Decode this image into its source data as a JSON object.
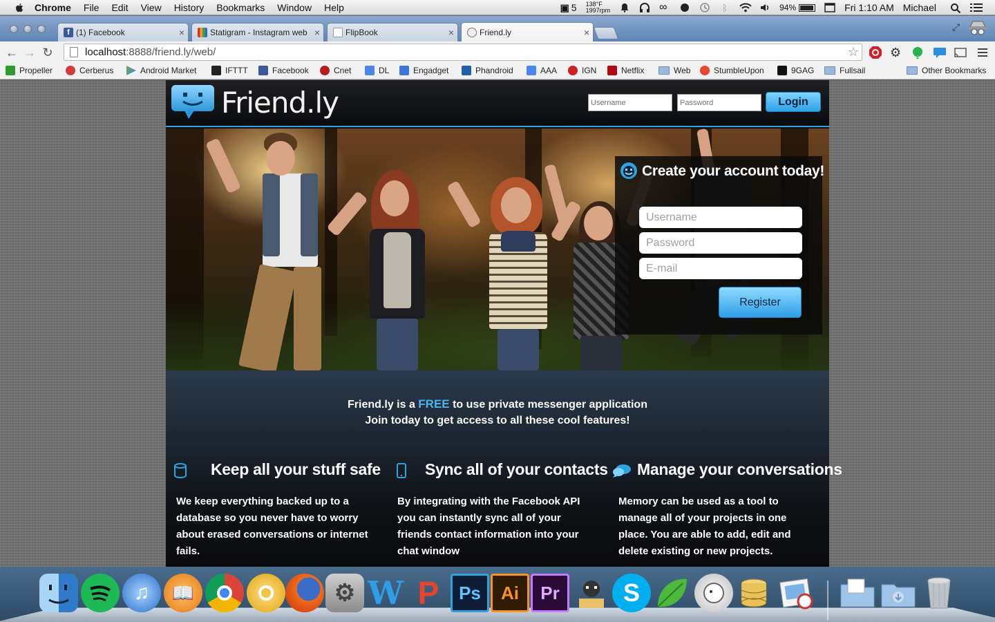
{
  "menubar": {
    "app_name": "Chrome",
    "menus": [
      "File",
      "Edit",
      "View",
      "History",
      "Bookmarks",
      "Window",
      "Help"
    ],
    "status_count": "5",
    "temp_line1": "138°F",
    "temp_line2": "1997rpm",
    "battery": "94%",
    "clock": "Fri 1:10 AM",
    "user": "Michael"
  },
  "tabs": [
    {
      "title": "(1) Facebook",
      "favicon_color": "#3b5998"
    },
    {
      "title": "Statigram - Instagram web",
      "favicon_color": "#8a5a2b"
    },
    {
      "title": "FlipBook",
      "favicon_color": "#ffffff"
    },
    {
      "title": "Friend.ly",
      "favicon_color": "#cccccc"
    }
  ],
  "address_bar": {
    "host": "localhost",
    "path": ":8888/friend.ly/web/"
  },
  "bookmarks": [
    {
      "label": "Propeller",
      "color": "#2f9b2f"
    },
    {
      "label": "Cerberus",
      "color": "#d23b3b"
    },
    {
      "label": "Android Market",
      "color": "#6aa84f"
    },
    {
      "label": "IFTTT",
      "color": "#222222"
    },
    {
      "label": "Facebook",
      "color": "#3b5998"
    },
    {
      "label": "Cnet",
      "color": "#b71c1c"
    },
    {
      "label": "DL",
      "color": "#4a86e8"
    },
    {
      "label": "Engadget",
      "color": "#3c78d8"
    },
    {
      "label": "Phandroid",
      "color": "#1f5fa8"
    },
    {
      "label": "AAA",
      "color": "#4a86e8"
    },
    {
      "label": "IGN",
      "color": "#cc2222"
    },
    {
      "label": "Netflix",
      "color": "#b20710"
    },
    {
      "label": "Web",
      "color": "folder"
    },
    {
      "label": "StumbleUpon",
      "color": "#e8452c"
    },
    {
      "label": "9GAG",
      "color": "#111111"
    },
    {
      "label": "Fullsail",
      "color": "folder"
    }
  ],
  "other_bookmarks": "Other Bookmarks",
  "site": {
    "logo_text": "Friend.ly",
    "header_username_placeholder": "Username",
    "header_password_placeholder": "Password",
    "login_label": "Login",
    "register": {
      "title": "Create your account today!",
      "username_placeholder": "Username",
      "password_placeholder": "Password",
      "email_placeholder": "E-mail",
      "button_label": "Register"
    },
    "tagline_pre": "Friend.ly is a",
    "tagline_free": "FREE",
    "tagline_post": "to use private messenger application",
    "tagline_line2": "Join today to get access to all these cool features!",
    "features": [
      {
        "title": "Keep all your stuff safe",
        "text": "We keep everything backed up to a database so you never have to worry about erased conversations or internet fails."
      },
      {
        "title": "Sync all of your contacts",
        "text": "By integrating with the Facebook API you can instantly sync all of your friends contact information into your chat window"
      },
      {
        "title": "Manage your conversations",
        "text": "Memory can be used as a tool to manage all of your projects in one place. You are able to add, edit and delete existing or new projects."
      }
    ]
  },
  "colors": {
    "accent": "#2fa3e0",
    "free_highlight": "#4ab6f0"
  },
  "dock": [
    {
      "name": "finder-icon"
    },
    {
      "name": "spotify-icon"
    },
    {
      "name": "itunes-icon"
    },
    {
      "name": "ibooks-icon"
    },
    {
      "name": "chrome-icon"
    },
    {
      "name": "chrome-canary-icon"
    },
    {
      "name": "firefox-icon"
    },
    {
      "name": "system-preferences-icon"
    },
    {
      "name": "word-icon",
      "glyph": "W"
    },
    {
      "name": "pages-icon",
      "glyph": "P"
    },
    {
      "name": "photoshop-icon",
      "glyph": "Ps"
    },
    {
      "name": "illustrator-icon",
      "glyph": "Ai"
    },
    {
      "name": "premiere-icon",
      "glyph": "Pr"
    },
    {
      "name": "github-icon"
    },
    {
      "name": "skype-icon",
      "glyph": "S"
    },
    {
      "name": "leaf-icon"
    },
    {
      "name": "sequel-pro-icon"
    },
    {
      "name": "database-icon"
    },
    {
      "name": "preview-icon"
    },
    {
      "name": "documents-folder-icon"
    },
    {
      "name": "downloads-folder-icon"
    },
    {
      "name": "trash-icon"
    }
  ]
}
